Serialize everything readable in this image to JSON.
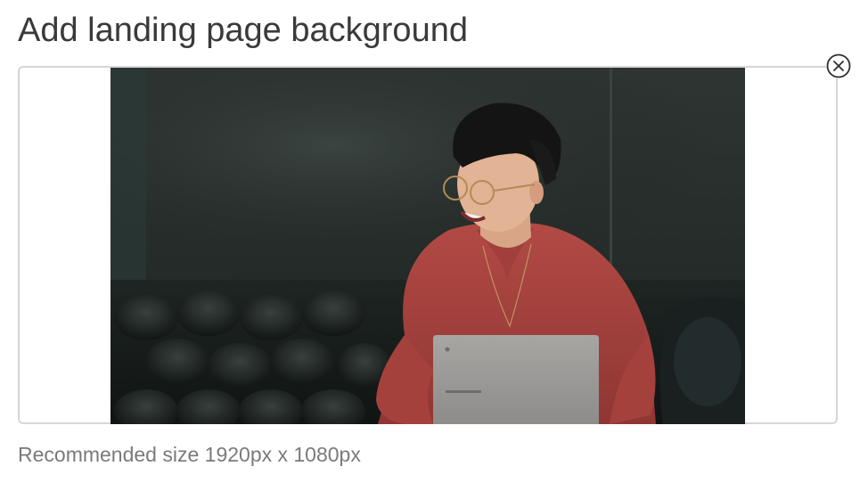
{
  "section": {
    "title": "Add landing page background"
  },
  "upload": {
    "hint": "Recommended size 1920px x 1080px",
    "preview_alt": "Smiling person in red sweater with laptop on leather sofa",
    "remove_icon": "close-circle-icon"
  },
  "colors": {
    "title_text": "#3a3a3a",
    "hint_text": "#7a7a7a",
    "border": "#d6d6d6"
  }
}
